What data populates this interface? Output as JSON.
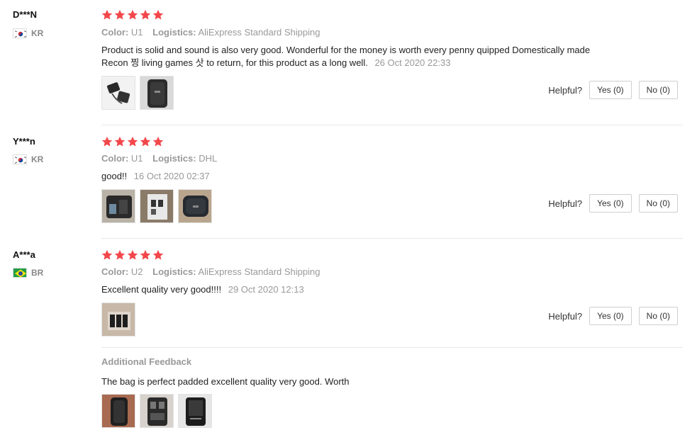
{
  "reviews": [
    {
      "user": "D***N",
      "country": "KR",
      "flag": "korea",
      "rating": 5,
      "color_label": "Color:",
      "color_value": "U1",
      "logistics_label": "Logistics:",
      "logistics_value": "AliExpress Standard Shipping",
      "text": "Product is solid and sound is also very good. Wonderful for the money is worth every penny quipped Domestically made Recon 찡 living games 삿 to return, for this product as a long well.",
      "date": "26 Oct 2020 22:33",
      "photo_count": 2,
      "helpful_label": "Helpful?",
      "yes_label": "Yes (0)",
      "no_label": "No (0)"
    },
    {
      "user": "Y***n",
      "country": "KR",
      "flag": "korea",
      "rating": 5,
      "color_label": "Color:",
      "color_value": "U1",
      "logistics_label": "Logistics:",
      "logistics_value": "DHL",
      "text": "good!!",
      "date": "16 Oct 2020 02:37",
      "photo_count": 3,
      "helpful_label": "Helpful?",
      "yes_label": "Yes (0)",
      "no_label": "No (0)"
    },
    {
      "user": "A***a",
      "country": "BR",
      "flag": "brazil",
      "rating": 5,
      "color_label": "Color:",
      "color_value": "U2",
      "logistics_label": "Logistics:",
      "logistics_value": "AliExpress Standard Shipping",
      "text": "Excellent quality very good!!!!",
      "date": "29 Oct 2020 12:13",
      "photo_count": 1,
      "helpful_label": "Helpful?",
      "yes_label": "Yes (0)",
      "no_label": "No (0)",
      "additional_feedback": {
        "title": "Additional Feedback",
        "text": "The bag is perfect padded excellent quality very good. Worth",
        "photo_count": 3
      }
    }
  ],
  "colors": {
    "star": "#f2474b",
    "muted_text": "#999999",
    "divider": "#e8e8e8"
  }
}
